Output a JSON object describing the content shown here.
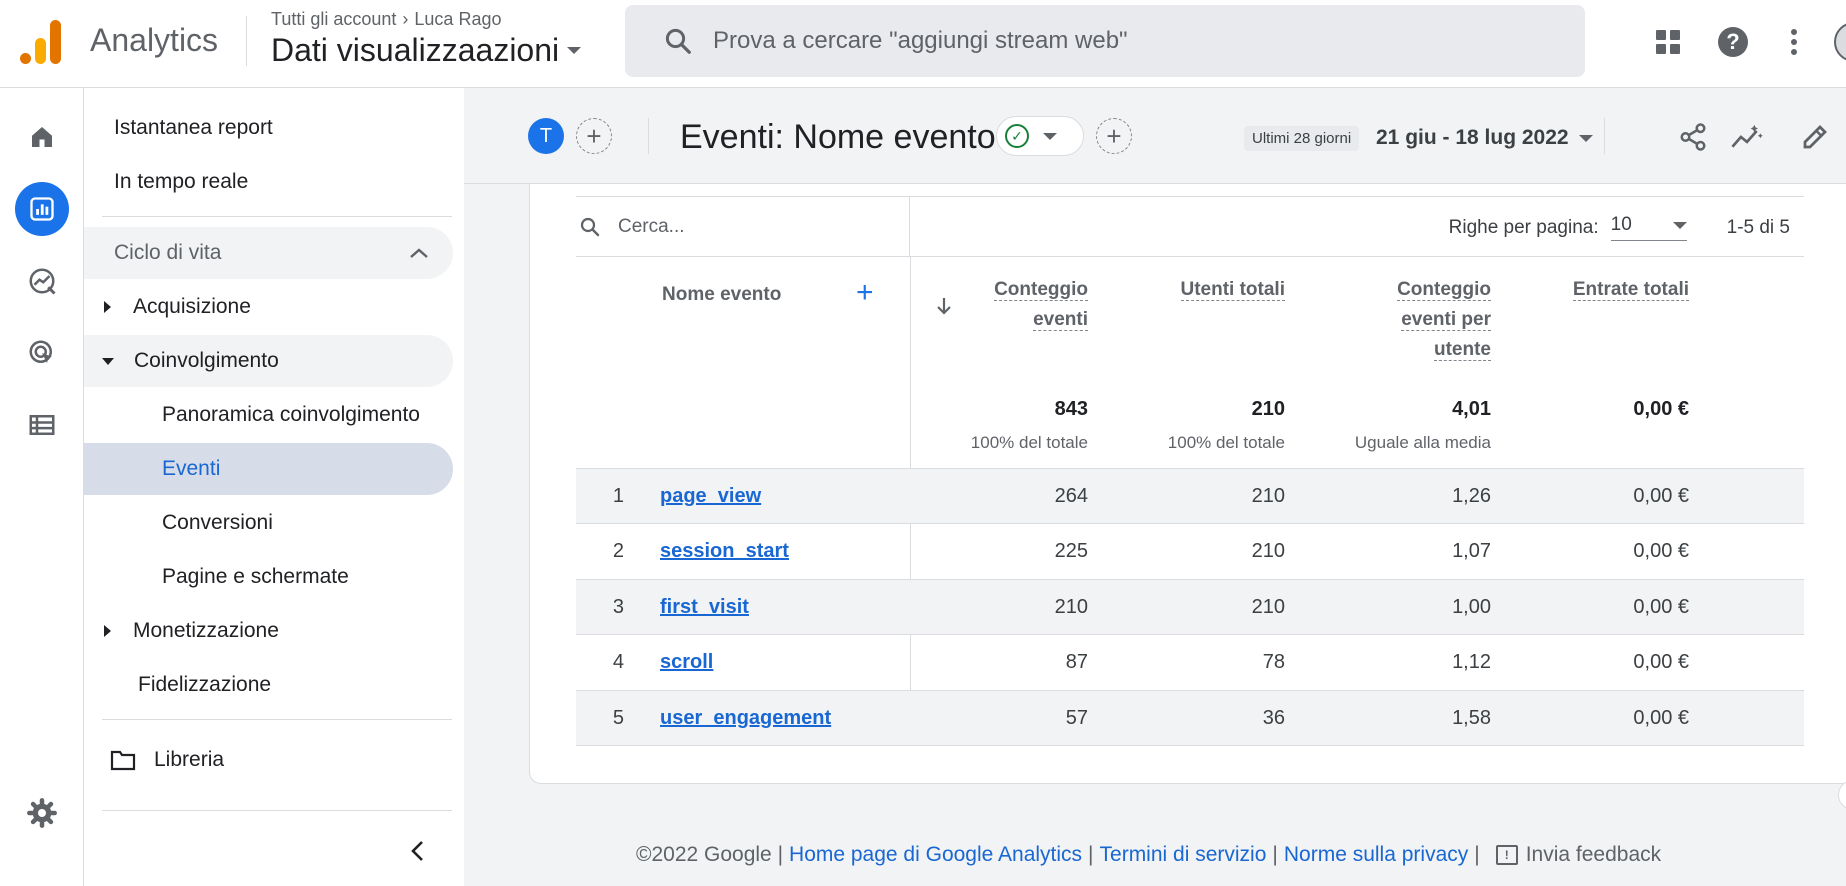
{
  "app": {
    "name": "Analytics"
  },
  "account": {
    "breadcrumb_parent": "Tutti gli account",
    "breadcrumb_child": "Luca Rago",
    "property": "Dati visualizzaazioni"
  },
  "search": {
    "placeholder": "Prova a cercare \"aggiungi stream web\""
  },
  "nav": {
    "items": [
      {
        "label": "Istantanea report"
      },
      {
        "label": "In tempo reale"
      },
      {
        "label": "Ciclo di vita"
      },
      {
        "label": "Acquisizione"
      },
      {
        "label": "Coinvolgimento"
      },
      {
        "label": "Panoramica coinvolgimento"
      },
      {
        "label": "Eventi"
      },
      {
        "label": "Conversioni"
      },
      {
        "label": "Pagine e schermate"
      },
      {
        "label": "Monetizzazione"
      },
      {
        "label": "Fidelizzazione"
      },
      {
        "label": "Libreria"
      }
    ]
  },
  "report": {
    "avatar_letter": "T",
    "title": "Eventi: Nome evento",
    "date_chip": "Ultimi 28 giorni",
    "date_range": "21 giu - 18 lug 2022"
  },
  "table": {
    "search_placeholder": "Cerca...",
    "rows_per_page_label": "Righe per pagina:",
    "rows_per_page_value": "10",
    "pagination": "1-5 di 5",
    "dimension_header": "Nome evento",
    "columns": [
      {
        "l1": "Conteggio",
        "l2": "eventi",
        "l3": ""
      },
      {
        "l1": "Utenti totali",
        "l2": "",
        "l3": ""
      },
      {
        "l1": "Conteggio",
        "l2": "eventi per",
        "l3": "utente"
      },
      {
        "l1": "Entrate totali",
        "l2": "",
        "l3": ""
      }
    ],
    "totals": [
      {
        "value": "843",
        "sub": "100% del totale"
      },
      {
        "value": "210",
        "sub": "100% del totale"
      },
      {
        "value": "4,01",
        "sub": "Uguale alla media"
      },
      {
        "value": "0,00 €",
        "sub": ""
      }
    ],
    "rows": [
      {
        "idx": "1",
        "name": "page_view",
        "c1": "264",
        "c2": "210",
        "c3": "1,26",
        "c4": "0,00 €"
      },
      {
        "idx": "2",
        "name": "session_start",
        "c1": "225",
        "c2": "210",
        "c3": "1,07",
        "c4": "0,00 €"
      },
      {
        "idx": "3",
        "name": "first_visit",
        "c1": "210",
        "c2": "210",
        "c3": "1,00",
        "c4": "0,00 €"
      },
      {
        "idx": "4",
        "name": "scroll",
        "c1": "87",
        "c2": "78",
        "c3": "1,12",
        "c4": "0,00 €"
      },
      {
        "idx": "5",
        "name": "user_engagement",
        "c1": "57",
        "c2": "36",
        "c3": "1,58",
        "c4": "0,00 €"
      }
    ]
  },
  "footer": {
    "copyright": "©2022 Google |",
    "link1": "Home page di Google Analytics",
    "sep": "|",
    "link2": "Termini di servizio",
    "link3": "Norme sulla privacy",
    "feedback": "Invia feedback"
  },
  "colors": {
    "accent": "#1a73e8",
    "link": "#1967d2",
    "success": "#188038",
    "logo_orange": "#e37400",
    "logo_yellow": "#f9ab00"
  }
}
